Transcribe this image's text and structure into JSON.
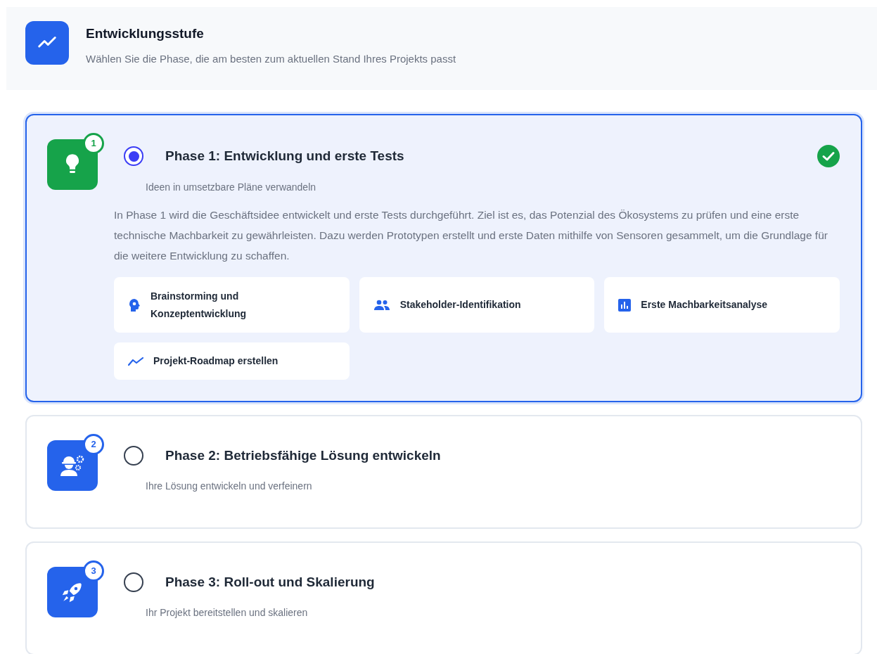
{
  "header": {
    "title": "Entwicklungsstufe",
    "subtitle": "Wählen Sie die Phase, die am besten zum aktuellen Stand Ihres Projekts passt"
  },
  "phases": [
    {
      "number": "1",
      "title": "Phase 1: Entwicklung und erste Tests",
      "subtitle": "Ideen in umsetzbare Pläne verwandeln",
      "selected": true,
      "description": "In Phase 1 wird die Geschäftsidee entwickelt und erste Tests durchgeführt. Ziel ist es, das Potenzial des Ökosystems zu prüfen und eine erste technische Machbarkeit zu gewährleisten. Dazu werden Prototypen erstellt und erste Daten mithilfe von Sensoren gesammelt, um die Grundlage für die weitere Entwicklung zu schaffen.",
      "features": [
        "Brainstorming und Konzeptentwicklung",
        "Stakeholder-Identifikation",
        "Erste Machbarkeitsanalyse",
        "Projekt-Roadmap erstellen"
      ]
    },
    {
      "number": "2",
      "title": "Phase 2: Betriebsfähige Lösung entwickeln",
      "subtitle": "Ihre Lösung entwickeln und verfeinern",
      "selected": false
    },
    {
      "number": "3",
      "title": "Phase 3: Roll-out und Skalierung",
      "subtitle": "Ihr Projekt bereitstellen und skalieren",
      "selected": false
    }
  ]
}
